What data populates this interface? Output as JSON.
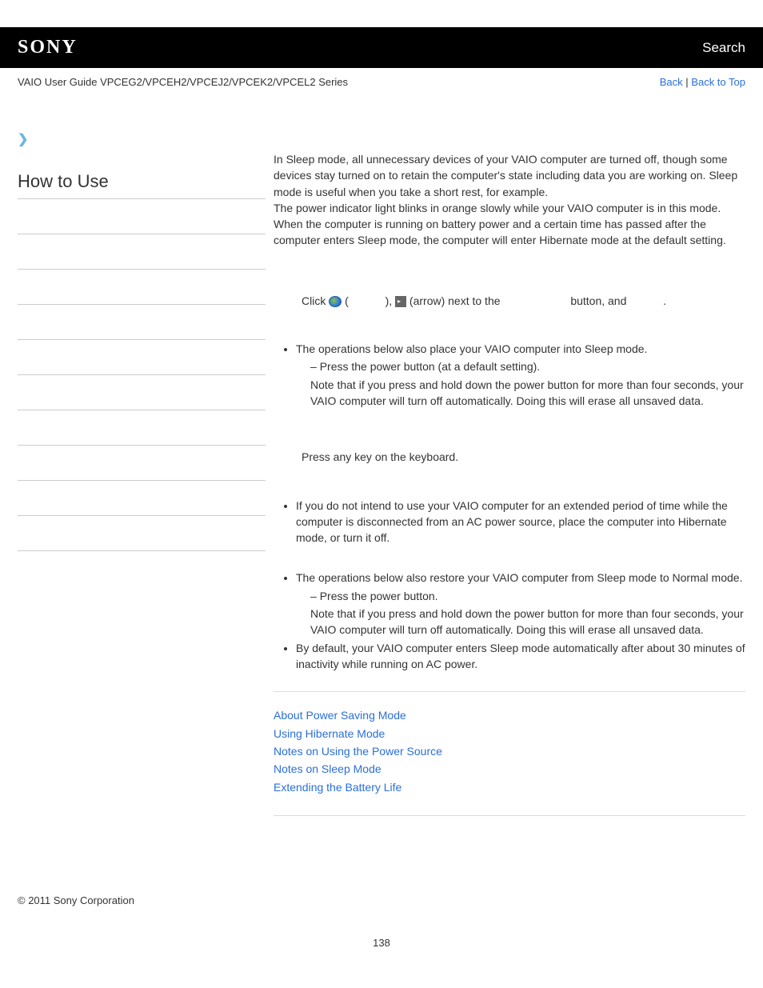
{
  "header": {
    "logo": "SONY",
    "search": "Search"
  },
  "subbar": {
    "guide": "VAIO User Guide VPCEG2/VPCEH2/VPCEJ2/VPCEK2/VPCEL2 Series",
    "back": "Back",
    "top": "Back to Top"
  },
  "sidebar": {
    "title": "How to Use"
  },
  "content": {
    "intro": "In Sleep mode, all unnecessary devices of your VAIO computer are turned off, though some devices stay turned on to retain the computer's state including data you are working on. Sleep mode is useful when you take a short rest, for example.",
    "intro2": "The power indicator light blinks in orange slowly while your VAIO computer is in this mode. When the computer is running on battery power and a certain time has passed after the computer enters Sleep mode, the computer will enter Hibernate mode at the default setting.",
    "inst_click": "Click ",
    "inst_paren_open": " (",
    "inst_paren_close": "), ",
    "inst_arrow": " (arrow) next to the",
    "inst_button": "button, and",
    "inst_end": ".",
    "li1": "The operations below also place your VAIO computer into Sleep mode.",
    "li1_sub": "Press the power button (at a default setting).",
    "li1_note": "Note that if you press and hold down the power button for more than four seconds, your VAIO computer will turn off automatically. Doing this will erase all unsaved data.",
    "resume": "Press any key on the keyboard.",
    "li2": "If you do not intend to use your VAIO computer for an extended period of time while the computer is disconnected from an AC power source, place the computer into Hibernate mode, or turn it off.",
    "li3": "The operations below also restore your VAIO computer from Sleep mode to Normal mode.",
    "li3_sub": "Press the power button.",
    "li3_note": "Note that if you press and hold down the power button for more than four seconds, your VAIO computer will turn off automatically. Doing this will erase all unsaved data.",
    "li4": "By default, your VAIO computer enters Sleep mode automatically after about 30 minutes of inactivity while running on AC power.",
    "related": [
      "About Power Saving Mode",
      "Using Hibernate Mode",
      "Notes on Using the Power Source",
      "Notes on Sleep Mode",
      "Extending the Battery Life"
    ]
  },
  "footer": {
    "copyright": "© 2011 Sony Corporation",
    "page": "138"
  }
}
